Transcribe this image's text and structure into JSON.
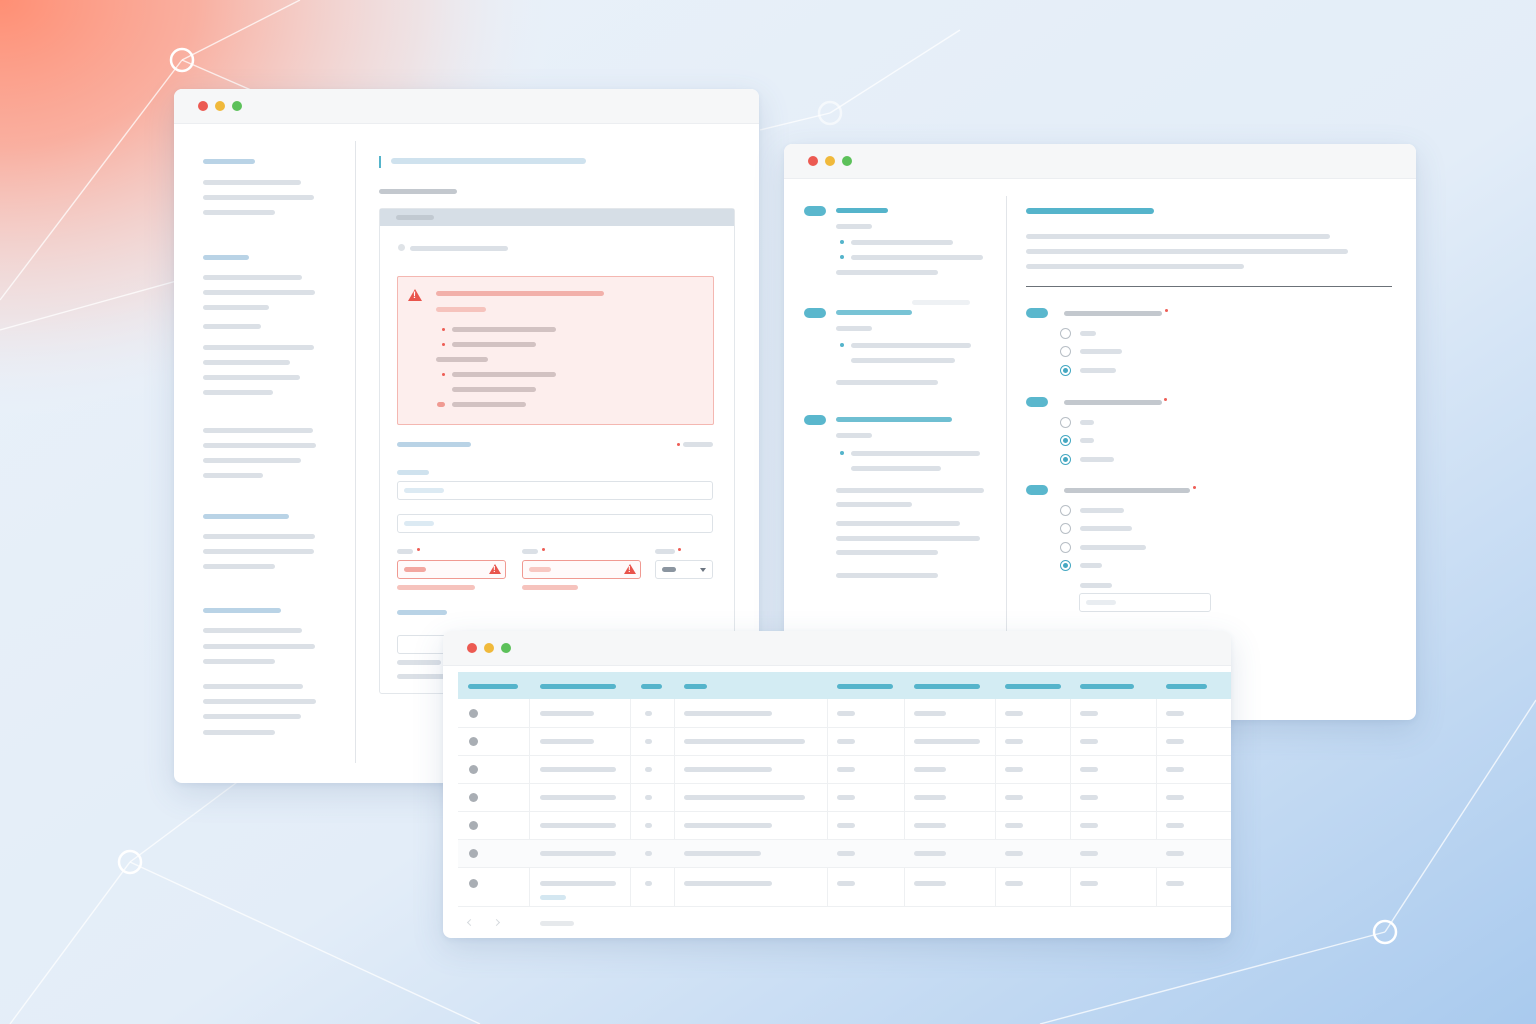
{
  "windows": {
    "form_window": {
      "controls": [
        "close",
        "minimize",
        "maximize"
      ],
      "alert": {
        "icon": "warning-icon",
        "color": "#e9544c"
      },
      "field_error_icon": "warning-icon",
      "select_caret_icon": "chevron-down-icon"
    },
    "survey_window": {
      "controls": [
        "close",
        "minimize",
        "maximize"
      ],
      "questions": [
        {
          "options": 3,
          "selected_index": 2
        },
        {
          "options": 3,
          "selected_index": 1
        },
        {
          "options": 4,
          "selected_index": 3
        }
      ]
    },
    "table_window": {
      "controls": [
        "close",
        "minimize",
        "maximize"
      ],
      "columns": 9,
      "rows": 7,
      "header_color": "#d3ecf3"
    }
  },
  "colors": {
    "accent": "#55b4cb",
    "error": "#e9544c",
    "error_bg": "#fdeeed",
    "window_close": "#ec5a52",
    "window_minimize": "#f0b93b",
    "window_maximize": "#5cc15a"
  }
}
